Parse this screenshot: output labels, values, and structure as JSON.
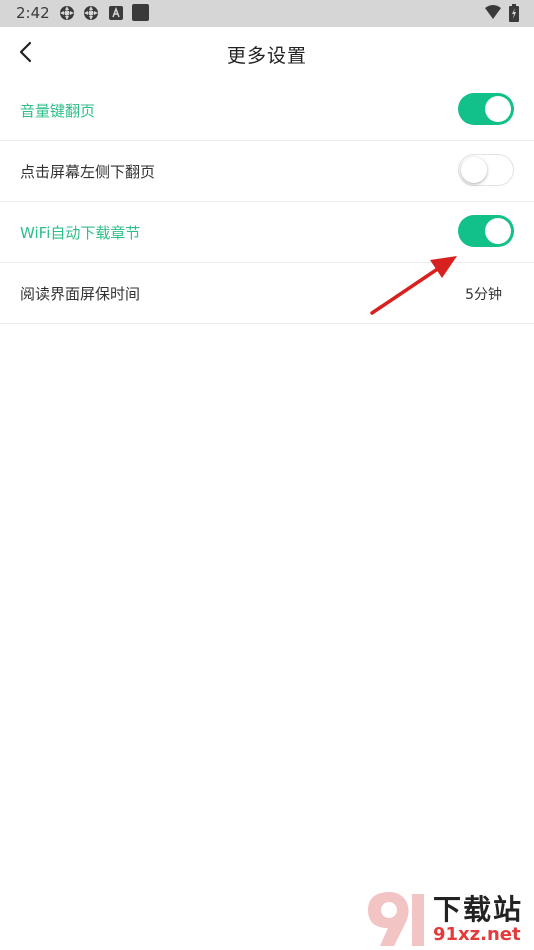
{
  "status_bar": {
    "time": "2:42",
    "icons": [
      "settings-sync-icon",
      "settings-sync-icon",
      "a-box-icon",
      "square-icon"
    ],
    "right_icons": [
      "wifi-icon",
      "battery-charging-icon"
    ],
    "background": "#d6d6d6"
  },
  "app_bar": {
    "back_icon": "chevron-left-icon",
    "title": "更多设置"
  },
  "settings": [
    {
      "label": "音量键翻页",
      "type": "toggle",
      "on": true
    },
    {
      "label": "点击屏幕左侧下翻页",
      "type": "toggle",
      "on": false
    },
    {
      "label": "WiFi自动下载章节",
      "type": "toggle",
      "on": true
    },
    {
      "label": "阅读界面屏保时间",
      "type": "value",
      "value": "5分钟"
    }
  ],
  "colors": {
    "accent_green": "#12c08a",
    "label_green": "#2fbf8a",
    "arrow_red": "#d8201f"
  },
  "watermark": {
    "text": "下载站",
    "url": "91xz.net"
  }
}
